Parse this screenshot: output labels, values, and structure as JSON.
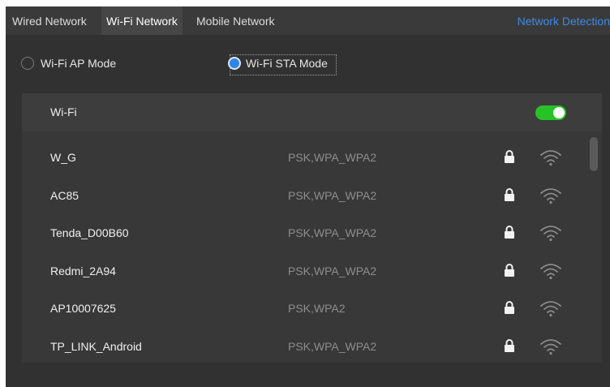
{
  "tabs": [
    {
      "label": "Wired Network",
      "active": false
    },
    {
      "label": "Wi-Fi Network",
      "active": true
    },
    {
      "label": "Mobile Network",
      "active": false
    }
  ],
  "network_detection_label": "Network Detection",
  "modes": {
    "ap": {
      "label": "Wi-Fi AP Mode",
      "selected": false
    },
    "sta": {
      "label": "Wi-Fi STA Mode",
      "selected": true
    }
  },
  "wifi": {
    "title": "Wi-Fi",
    "enabled": true,
    "toggle_color": "#27c227",
    "networks": [
      {
        "name": "W_G",
        "security": "PSK,WPA_WPA2",
        "icons": [
          "lock-icon",
          "wifi-signal-icon"
        ]
      },
      {
        "name": "AC85",
        "security": "PSK,WPA_WPA2",
        "icons": [
          "lock-icon",
          "wifi-signal-icon"
        ]
      },
      {
        "name": "Tenda_D00B60",
        "security": "PSK,WPA_WPA2",
        "icons": [
          "lock-icon",
          "wifi-signal-icon"
        ]
      },
      {
        "name": "Redmi_2A94",
        "security": "PSK,WPA_WPA2",
        "icons": [
          "lock-icon",
          "wifi-signal-icon"
        ]
      },
      {
        "name": "AP10007625",
        "security": "PSK,WPA2",
        "icons": [
          "lock-icon",
          "wifi-signal-icon"
        ]
      },
      {
        "name": "TP_LINK_Android",
        "security": "PSK,WPA_WPA2",
        "icons": [
          "lock-icon",
          "wifi-signal-icon"
        ]
      }
    ]
  },
  "colors": {
    "accent_link": "#3d8ae5",
    "radio_selected": "#2f86e8",
    "background": "#313131"
  }
}
